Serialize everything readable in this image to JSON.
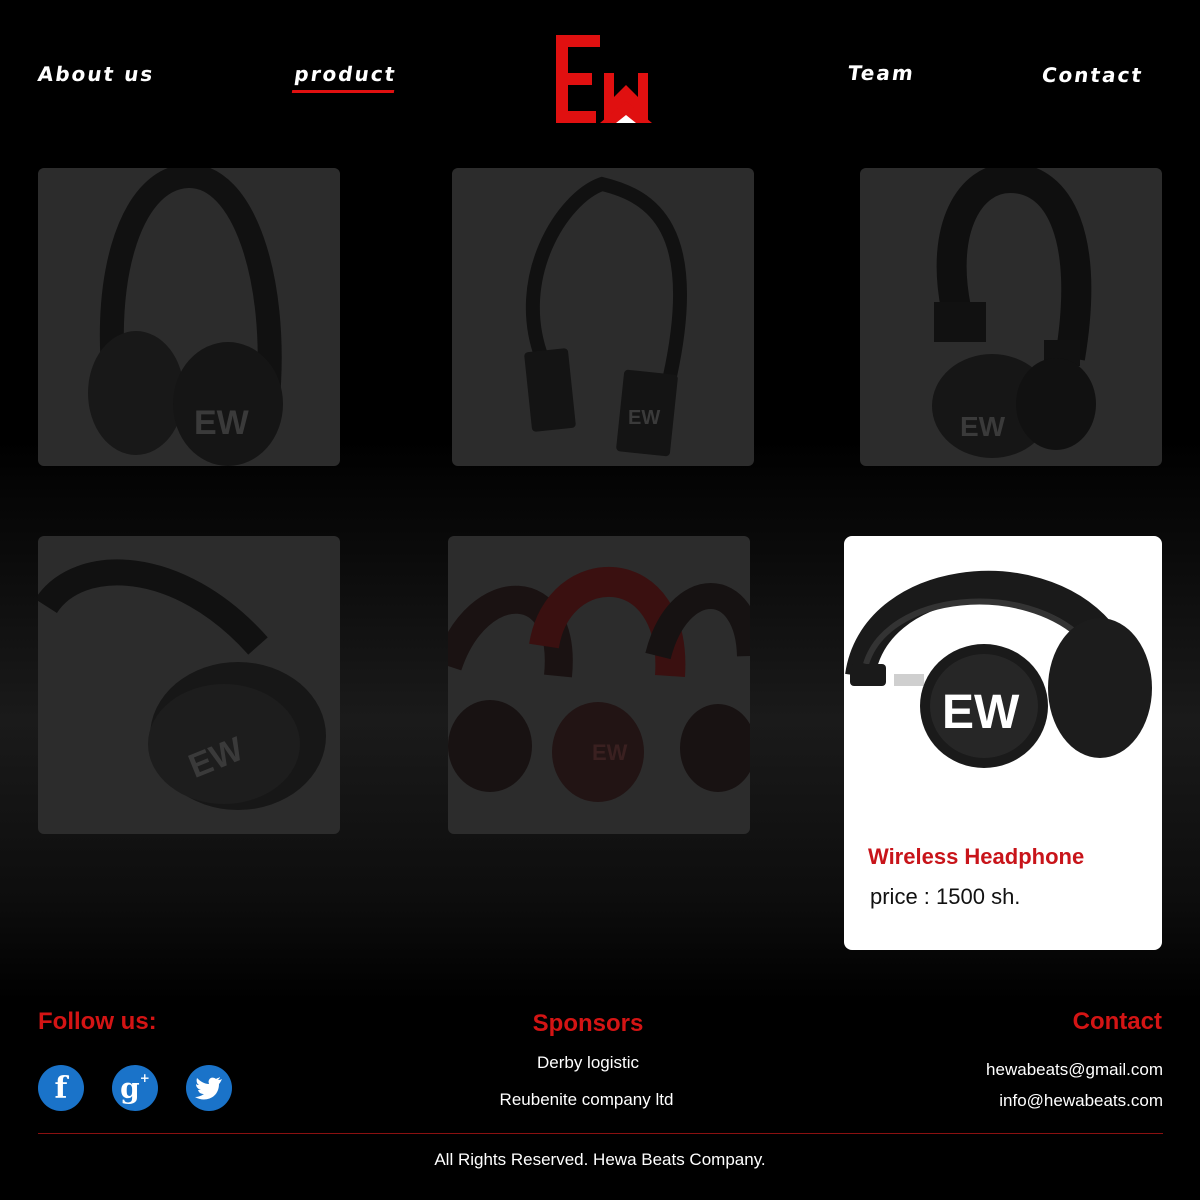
{
  "nav": {
    "about": "About us",
    "product": "product",
    "team": "Team",
    "contact": "Contact"
  },
  "brand": {
    "logo_text": "EW",
    "accent_color": "#e01010"
  },
  "products": [
    {
      "image": "headphone-black-over-ear-icon"
    },
    {
      "image": "headphone-band-icon"
    },
    {
      "image": "headphone-classic-icon"
    },
    {
      "image": "headphone-noise-cancel-icon"
    },
    {
      "image": "headphones-group-icon"
    }
  ],
  "featured": {
    "title": "Wireless Headphone",
    "price": "price : 1500 sh."
  },
  "footer": {
    "follow_heading": "Follow us:",
    "social": [
      "facebook-icon",
      "google-plus-icon",
      "twitter-icon"
    ],
    "sponsors_heading": "Sponsors",
    "sponsors": [
      "Derby logistic",
      "Reubenite company ltd"
    ],
    "contact_heading": "Contact",
    "emails": [
      "hewabeats@gmail.com",
      "info@hewabeats.com"
    ],
    "copyright": "All Rights Reserved. Hewa Beats Company."
  }
}
